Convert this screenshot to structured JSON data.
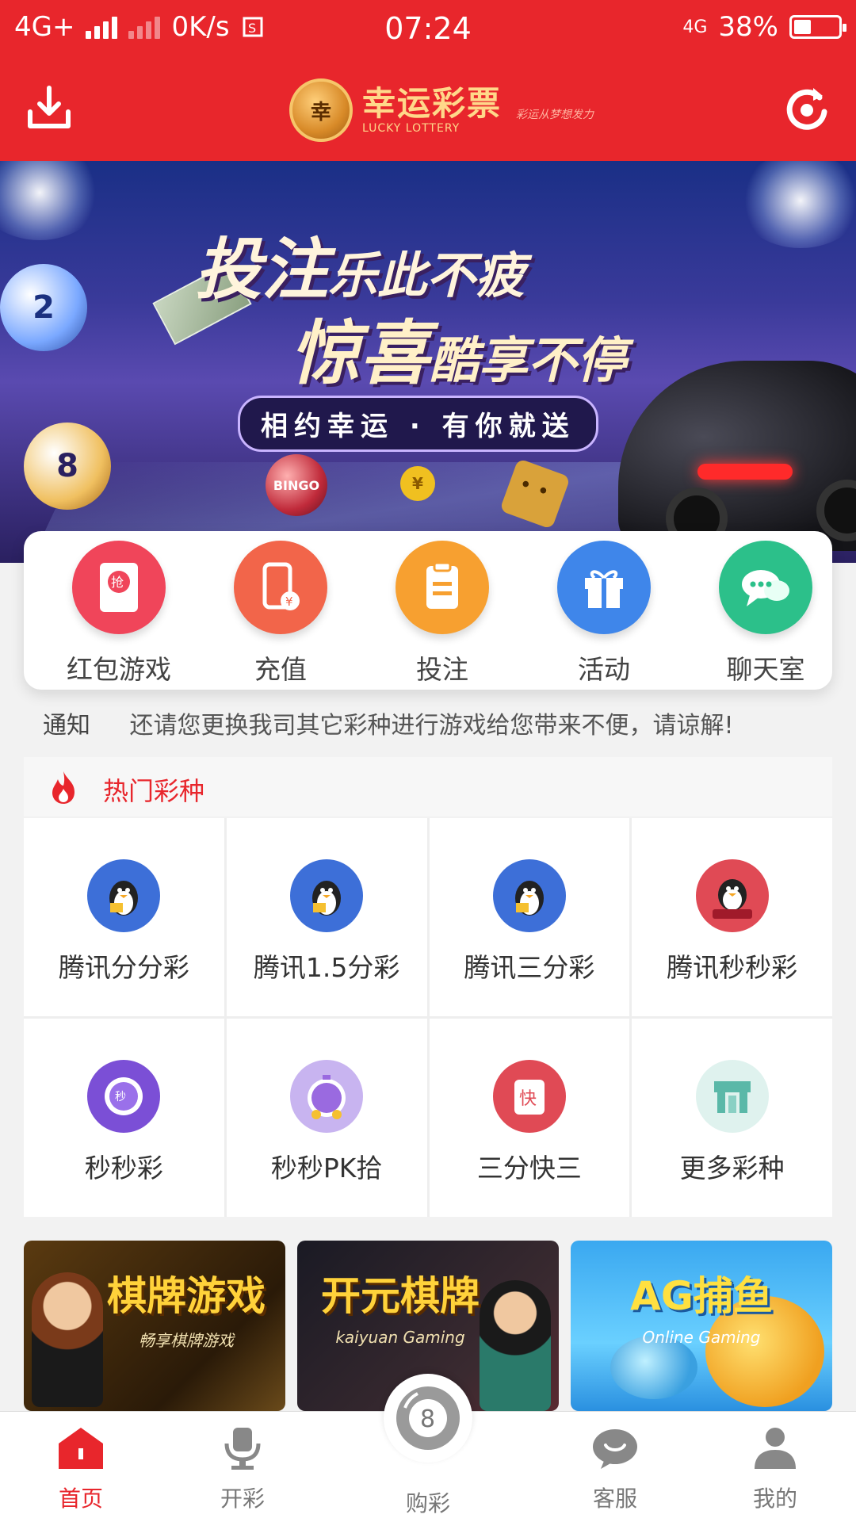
{
  "status_bar": {
    "network": "4G+",
    "speed": "0K/s",
    "time": "07:24",
    "network_right": "4G",
    "battery": "38%",
    "battery_level": 0.38
  },
  "header": {
    "logo_cn": "幸运彩票",
    "logo_en": "LUCKY LOTTERY",
    "logo_emblem": "幸",
    "logo_slogan": "彩运从梦想发力"
  },
  "banner": {
    "line1_big": "投注",
    "line1_small": "乐此不疲",
    "line2_big": "惊喜",
    "line2_small": "酷享不停",
    "tagline": "相约幸运 · 有你就送"
  },
  "quick_menu": [
    {
      "label": "红包游戏",
      "icon": "red-envelope-icon",
      "color": "#f0455a",
      "glyph": "抢"
    },
    {
      "label": "充值",
      "icon": "phone-recharge-icon",
      "color": "#f2654a",
      "glyph": "¥"
    },
    {
      "label": "投注",
      "icon": "clipboard-icon",
      "color": "#f7a030",
      "glyph": ""
    },
    {
      "label": "活动",
      "icon": "gift-icon",
      "color": "#3f86ea",
      "glyph": ""
    },
    {
      "label": "聊天室",
      "icon": "chat-icon",
      "color": "#2cc08a",
      "glyph": ""
    }
  ],
  "notice": {
    "tag": "通知",
    "text": "还请您更换我司其它彩种进行游戏给您带来不便，请谅解!"
  },
  "hot": {
    "title": "热门彩种",
    "items": [
      {
        "name": "腾讯分分彩",
        "icon": "penguin-icon",
        "color": "#3d6fd8"
      },
      {
        "name": "腾讯1.5分彩",
        "icon": "penguin-icon",
        "color": "#3d6fd8"
      },
      {
        "name": "腾讯三分彩",
        "icon": "penguin-icon",
        "color": "#3d6fd8"
      },
      {
        "name": "腾讯秒秒彩",
        "icon": "penguin-icon",
        "color": "#e04a55"
      },
      {
        "name": "秒秒彩",
        "icon": "clock-lottery-icon",
        "color": "#7b4fd6"
      },
      {
        "name": "秒秒PK拾",
        "icon": "stopwatch-icon",
        "color": "#9a6ae0"
      },
      {
        "name": "三分快三",
        "icon": "mahjong-icon",
        "color": "#e04a55"
      },
      {
        "name": "更多彩种",
        "icon": "more-lottery-icon",
        "color": "#5ab8a8"
      }
    ]
  },
  "games": [
    {
      "title": "棋牌游戏",
      "subtitle": "畅享棋牌游戏"
    },
    {
      "title": "开元棋牌",
      "subtitle": "kaiyuan Gaming"
    },
    {
      "title": "AG捕鱼",
      "subtitle": "Online Gaming"
    }
  ],
  "tabbar": {
    "home": "首页",
    "results": "开彩",
    "buy": "购彩",
    "service": "客服",
    "mine": "我的",
    "active_color": "#e8262c"
  }
}
